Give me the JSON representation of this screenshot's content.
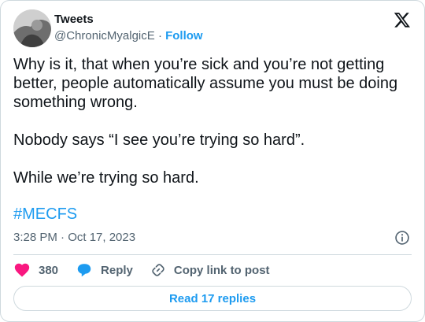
{
  "header": {
    "display_name": "Tweets",
    "handle": "@ChronicMyalgicE",
    "separator": "·",
    "follow_label": "Follow"
  },
  "tweet": {
    "paragraphs": [
      "Why is it, that when you’re sick and you’re not getting better, people automatically assume you must be doing something wrong.",
      "Nobody says “I see you’re trying so hard”.",
      "While we’re trying so hard."
    ],
    "hashtag": "#MECFS",
    "timestamp": "3:28 PM · Oct 17, 2023"
  },
  "actions": {
    "like_count": "380",
    "reply_label": "Reply",
    "copy_label": "Copy link to post"
  },
  "read_replies_label": "Read 17 replies",
  "colors": {
    "accent": "#1d9bf0",
    "like": "#f91880",
    "text": "#0f1419",
    "muted": "#536471",
    "border": "#cfd9de"
  },
  "icons": [
    "x-logo-icon",
    "info-icon",
    "heart-icon",
    "reply-bubble-icon",
    "link-icon"
  ]
}
